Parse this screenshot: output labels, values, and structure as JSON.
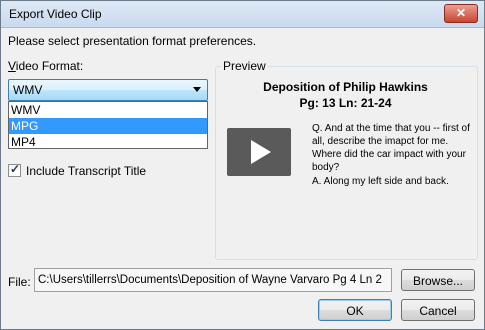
{
  "window": {
    "title": "Export Video Clip",
    "close_label": "✕"
  },
  "instruction": "Please select presentation format preferences.",
  "video_format": {
    "label_first": "V",
    "label_rest": "ideo Format:",
    "selected": "WMV",
    "options": [
      "WMV",
      "MPG",
      "MP4"
    ],
    "highlighted": "MPG"
  },
  "include_title": {
    "label": "Include Transcript Title",
    "checked": true,
    "mark": "✓"
  },
  "preview": {
    "legend": "Preview",
    "title": "Deposition of Philip Hawkins",
    "subtitle": "Pg: 13 Ln: 21-24",
    "question": "Q.   And at the time that you -- first of all, describe the imapct for me. Where did the car impact with your body?",
    "answer": "A.   Along my left side and back."
  },
  "file": {
    "label": "File:",
    "value": "C:\\Users\\tillerrs\\Documents\\Deposition of Wayne Varvaro Pg 4 Ln 2",
    "browse_label": "Browse..."
  },
  "buttons": {
    "ok": "OK",
    "cancel": "Cancel"
  }
}
